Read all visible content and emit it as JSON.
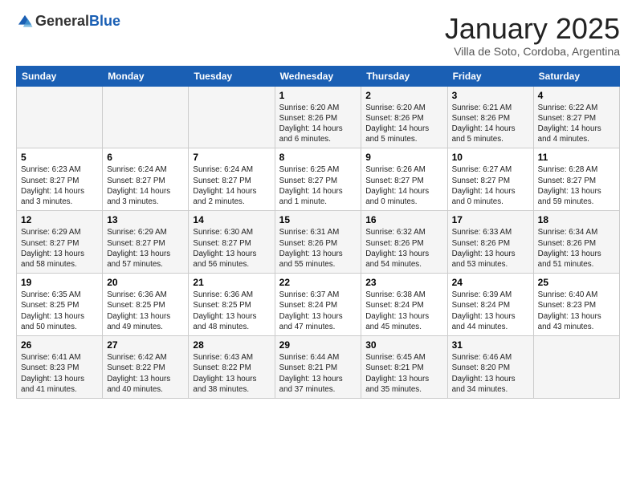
{
  "logo": {
    "general": "General",
    "blue": "Blue"
  },
  "title": "January 2025",
  "subtitle": "Villa de Soto, Cordoba, Argentina",
  "days_of_week": [
    "Sunday",
    "Monday",
    "Tuesday",
    "Wednesday",
    "Thursday",
    "Friday",
    "Saturday"
  ],
  "weeks": [
    [
      {
        "day": "",
        "info": ""
      },
      {
        "day": "",
        "info": ""
      },
      {
        "day": "",
        "info": ""
      },
      {
        "day": "1",
        "info": "Sunrise: 6:20 AM\nSunset: 8:26 PM\nDaylight: 14 hours\nand 6 minutes."
      },
      {
        "day": "2",
        "info": "Sunrise: 6:20 AM\nSunset: 8:26 PM\nDaylight: 14 hours\nand 5 minutes."
      },
      {
        "day": "3",
        "info": "Sunrise: 6:21 AM\nSunset: 8:26 PM\nDaylight: 14 hours\nand 5 minutes."
      },
      {
        "day": "4",
        "info": "Sunrise: 6:22 AM\nSunset: 8:27 PM\nDaylight: 14 hours\nand 4 minutes."
      }
    ],
    [
      {
        "day": "5",
        "info": "Sunrise: 6:23 AM\nSunset: 8:27 PM\nDaylight: 14 hours\nand 3 minutes."
      },
      {
        "day": "6",
        "info": "Sunrise: 6:24 AM\nSunset: 8:27 PM\nDaylight: 14 hours\nand 3 minutes."
      },
      {
        "day": "7",
        "info": "Sunrise: 6:24 AM\nSunset: 8:27 PM\nDaylight: 14 hours\nand 2 minutes."
      },
      {
        "day": "8",
        "info": "Sunrise: 6:25 AM\nSunset: 8:27 PM\nDaylight: 14 hours\nand 1 minute."
      },
      {
        "day": "9",
        "info": "Sunrise: 6:26 AM\nSunset: 8:27 PM\nDaylight: 14 hours\nand 0 minutes."
      },
      {
        "day": "10",
        "info": "Sunrise: 6:27 AM\nSunset: 8:27 PM\nDaylight: 14 hours\nand 0 minutes."
      },
      {
        "day": "11",
        "info": "Sunrise: 6:28 AM\nSunset: 8:27 PM\nDaylight: 13 hours\nand 59 minutes."
      }
    ],
    [
      {
        "day": "12",
        "info": "Sunrise: 6:29 AM\nSunset: 8:27 PM\nDaylight: 13 hours\nand 58 minutes."
      },
      {
        "day": "13",
        "info": "Sunrise: 6:29 AM\nSunset: 8:27 PM\nDaylight: 13 hours\nand 57 minutes."
      },
      {
        "day": "14",
        "info": "Sunrise: 6:30 AM\nSunset: 8:27 PM\nDaylight: 13 hours\nand 56 minutes."
      },
      {
        "day": "15",
        "info": "Sunrise: 6:31 AM\nSunset: 8:26 PM\nDaylight: 13 hours\nand 55 minutes."
      },
      {
        "day": "16",
        "info": "Sunrise: 6:32 AM\nSunset: 8:26 PM\nDaylight: 13 hours\nand 54 minutes."
      },
      {
        "day": "17",
        "info": "Sunrise: 6:33 AM\nSunset: 8:26 PM\nDaylight: 13 hours\nand 53 minutes."
      },
      {
        "day": "18",
        "info": "Sunrise: 6:34 AM\nSunset: 8:26 PM\nDaylight: 13 hours\nand 51 minutes."
      }
    ],
    [
      {
        "day": "19",
        "info": "Sunrise: 6:35 AM\nSunset: 8:25 PM\nDaylight: 13 hours\nand 50 minutes."
      },
      {
        "day": "20",
        "info": "Sunrise: 6:36 AM\nSunset: 8:25 PM\nDaylight: 13 hours\nand 49 minutes."
      },
      {
        "day": "21",
        "info": "Sunrise: 6:36 AM\nSunset: 8:25 PM\nDaylight: 13 hours\nand 48 minutes."
      },
      {
        "day": "22",
        "info": "Sunrise: 6:37 AM\nSunset: 8:24 PM\nDaylight: 13 hours\nand 47 minutes."
      },
      {
        "day": "23",
        "info": "Sunrise: 6:38 AM\nSunset: 8:24 PM\nDaylight: 13 hours\nand 45 minutes."
      },
      {
        "day": "24",
        "info": "Sunrise: 6:39 AM\nSunset: 8:24 PM\nDaylight: 13 hours\nand 44 minutes."
      },
      {
        "day": "25",
        "info": "Sunrise: 6:40 AM\nSunset: 8:23 PM\nDaylight: 13 hours\nand 43 minutes."
      }
    ],
    [
      {
        "day": "26",
        "info": "Sunrise: 6:41 AM\nSunset: 8:23 PM\nDaylight: 13 hours\nand 41 minutes."
      },
      {
        "day": "27",
        "info": "Sunrise: 6:42 AM\nSunset: 8:22 PM\nDaylight: 13 hours\nand 40 minutes."
      },
      {
        "day": "28",
        "info": "Sunrise: 6:43 AM\nSunset: 8:22 PM\nDaylight: 13 hours\nand 38 minutes."
      },
      {
        "day": "29",
        "info": "Sunrise: 6:44 AM\nSunset: 8:21 PM\nDaylight: 13 hours\nand 37 minutes."
      },
      {
        "day": "30",
        "info": "Sunrise: 6:45 AM\nSunset: 8:21 PM\nDaylight: 13 hours\nand 35 minutes."
      },
      {
        "day": "31",
        "info": "Sunrise: 6:46 AM\nSunset: 8:20 PM\nDaylight: 13 hours\nand 34 minutes."
      },
      {
        "day": "",
        "info": ""
      }
    ]
  ]
}
